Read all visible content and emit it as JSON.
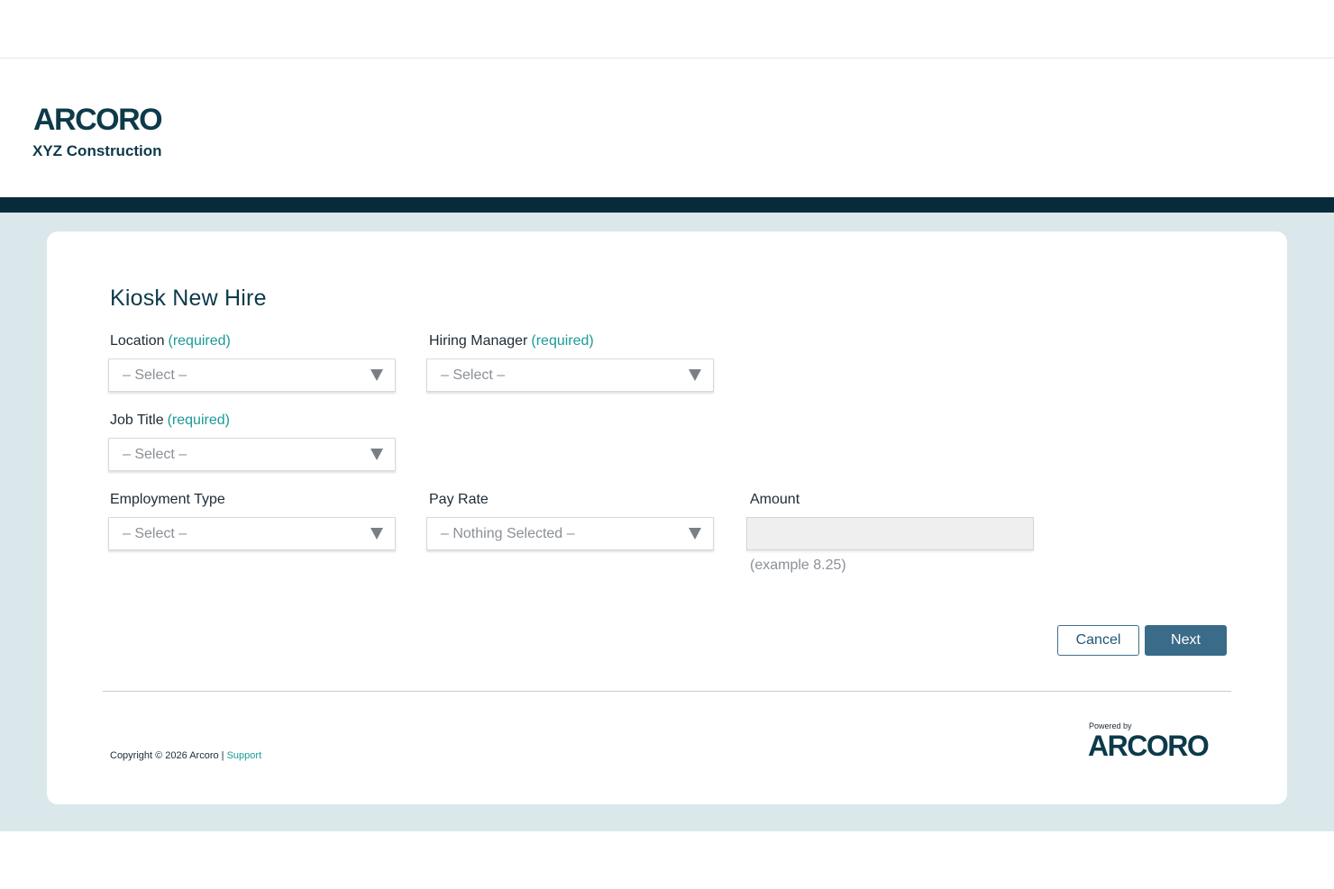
{
  "header": {
    "logo_text": "ARCORO",
    "company_name": "XYZ Construction"
  },
  "form": {
    "title": "Kiosk New Hire",
    "location": {
      "label": "Location",
      "required": "(required)",
      "value": "– Select –"
    },
    "hiring_manager": {
      "label": "Hiring Manager",
      "required": "(required)",
      "value": "– Select –"
    },
    "job_title": {
      "label": "Job Title",
      "required": "(required)",
      "value": "– Select –"
    },
    "employment_type": {
      "label": "Employment Type",
      "value": "– Select –"
    },
    "pay_rate": {
      "label": "Pay Rate",
      "value": "– Nothing Selected –"
    },
    "amount": {
      "label": "Amount",
      "value": "",
      "hint": "(example 8.25)"
    },
    "cancel_label": "Cancel",
    "next_label": "Next"
  },
  "footer": {
    "copyright": "Copyright © 2026 Arcoro | ",
    "support_link": "Support",
    "powered_by": "Powered by",
    "logo_text": "ARCORO"
  },
  "colors": {
    "brand_dark": "#082b3c",
    "accent_teal": "#1a9a9a",
    "button_primary": "#3a6b88",
    "page_background": "#dae7eb"
  }
}
